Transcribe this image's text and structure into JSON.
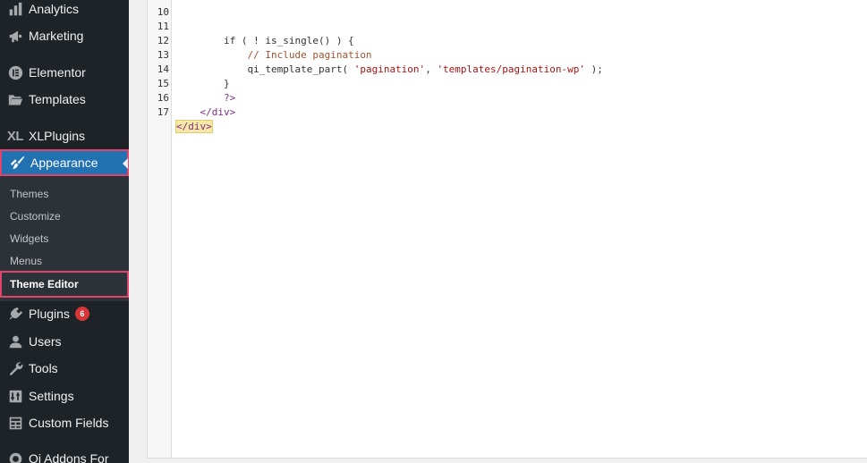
{
  "sidebar": {
    "items": [
      {
        "label": "Analytics",
        "icon": "bar-chart-icon"
      },
      {
        "label": "Marketing",
        "icon": "megaphone-icon"
      },
      {
        "label": "Elementor",
        "icon": "elementor-icon"
      },
      {
        "label": "Templates",
        "icon": "folder-icon"
      },
      {
        "label": "XLPlugins",
        "icon": "xl-icon",
        "glyph": "XL"
      },
      {
        "label": "Appearance",
        "icon": "paintbrush-icon",
        "active": true
      },
      {
        "label": "Plugins",
        "icon": "plugin-icon",
        "badge": "6"
      },
      {
        "label": "Users",
        "icon": "user-icon"
      },
      {
        "label": "Tools",
        "icon": "wrench-icon"
      },
      {
        "label": "Settings",
        "icon": "settings-icon"
      },
      {
        "label": "Custom Fields",
        "icon": "table-icon"
      },
      {
        "label": "Qi Addons For",
        "icon": "qi-icon"
      }
    ],
    "appearance_submenu": [
      {
        "label": "Themes"
      },
      {
        "label": "Customize"
      },
      {
        "label": "Widgets"
      },
      {
        "label": "Menus"
      },
      {
        "label": "Theme Editor",
        "current": true
      }
    ]
  },
  "colors": {
    "sidebar_bg": "#1d2327",
    "submenu_bg": "#2c3338",
    "active_bg": "#2271b1",
    "highlight_border": "#e0446d",
    "badge_bg": "#d63638"
  },
  "editor": {
    "partial_top_line": "10",
    "lines": [
      {
        "n": "11",
        "indent": "        ",
        "text": "if ( ! is_single() ) {",
        "kind": "code"
      },
      {
        "n": "12",
        "indent": "            ",
        "text": "// Include pagination",
        "kind": "comment"
      },
      {
        "n": "13",
        "indent": "            ",
        "fn": "qi_template_part( ",
        "s1": "'pagination'",
        "sep": ", ",
        "s2": "'templates/pagination-wp'",
        "end": " );",
        "kind": "call"
      },
      {
        "n": "14",
        "indent": "        ",
        "text": "}",
        "kind": "code"
      },
      {
        "n": "15",
        "indent": "        ",
        "text": "?>",
        "kind": "tag"
      },
      {
        "n": "16",
        "indent": "    ",
        "text": "</div>",
        "kind": "tag"
      },
      {
        "n": "17",
        "indent": "",
        "text": "</div>",
        "kind": "tag-match"
      }
    ]
  }
}
